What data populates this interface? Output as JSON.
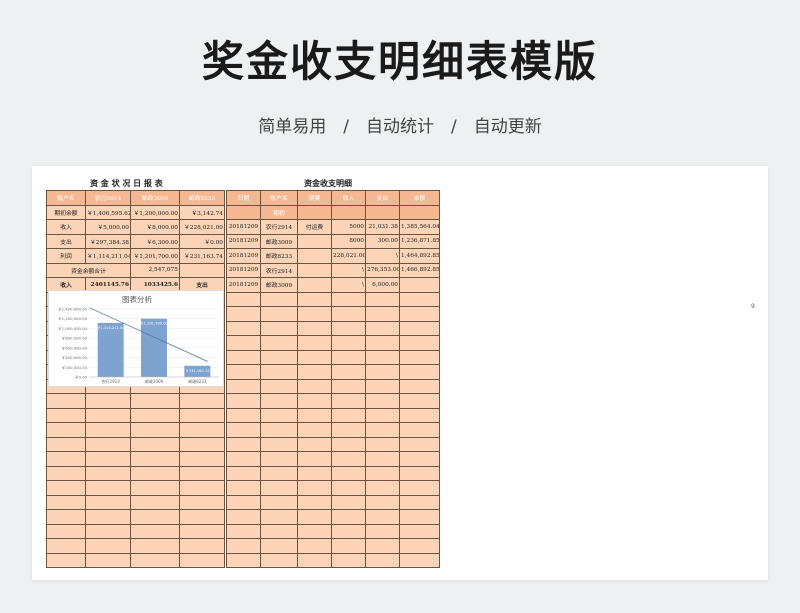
{
  "header": {
    "title": "奖金收支明细表模版",
    "subtitle": "简单易用　/　自动统计　/　自动更新"
  },
  "left": {
    "title": "资 金 状 况 日 报 表",
    "header": [
      "账户名",
      "农行2914",
      "邮政3009",
      "邮政8233"
    ],
    "rows": [
      [
        "期初余额",
        "￥1,406,595.62",
        "￥1,200,000.00",
        "￥3,142.74"
      ],
      [
        "收入",
        "￥5,000.00",
        "￥8,000.00",
        "￥228,021.00"
      ],
      [
        "支出",
        "￥297,384.38",
        "￥6,300.00",
        "￥0.00"
      ],
      [
        "利润",
        "￥1,114,211.04",
        "￥1,201,700.00",
        "￥231,163.74"
      ],
      [
        "资金余额合计",
        "",
        "2,547,075",
        ""
      ],
      [
        "收入",
        "2401145.76",
        "1033425.6",
        "支出"
      ]
    ]
  },
  "right": {
    "title": "资金收支明细",
    "header": [
      "日期",
      "账户名",
      "摘要",
      "收入",
      "支出",
      "余额"
    ],
    "subheader": "期初",
    "rows": [
      [
        "20181209",
        "农行2914",
        "付运费",
        "5000",
        "21,031.38",
        "1,385,564.04"
      ],
      [
        "20181209",
        "邮政3009",
        "",
        "8000",
        "300.00",
        "1,236,871.85"
      ],
      [
        "20181209",
        "邮政8233",
        "",
        "228,021.00",
        "\\",
        "1,464,892.85"
      ],
      [
        "20181209",
        "农行2914",
        "",
        "\\",
        "276,353.00",
        "1,466,892.85"
      ],
      [
        "20181209",
        "邮政3009",
        "",
        "\\",
        "6,000.00",
        ""
      ]
    ]
  },
  "page_number": "9",
  "chart_data": {
    "type": "bar",
    "title": "图表分析",
    "categories": [
      "农行2914",
      "邮政3009",
      "邮政8233"
    ],
    "values": [
      1114211.04,
      1201700.0,
      231163.74
    ],
    "data_labels": [
      "￥1,114,211.04",
      "￥1,201,700.00",
      "￥231,163.74"
    ],
    "ylim": [
      0,
      1400000
    ],
    "yticks": [
      "￥0.00",
      "￥200,000.00",
      "￥400,000.00",
      "￥600,000.00",
      "￥800,000.00",
      "￥1,000,000.00",
      "￥1,200,000.00",
      "￥1,400,000.00"
    ],
    "bar_color": "#7fa3d1",
    "trend": true,
    "grid": true
  },
  "colors": {
    "cell_fill": "#fbd3b6",
    "header_fill": "#f6b892",
    "border": "#6b5440"
  }
}
